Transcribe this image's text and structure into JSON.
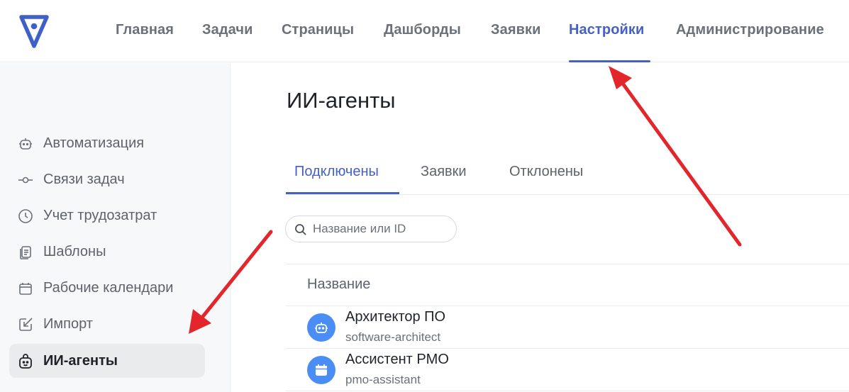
{
  "topnav": {
    "items": [
      {
        "label": "Главная"
      },
      {
        "label": "Задачи"
      },
      {
        "label": "Страницы"
      },
      {
        "label": "Дашборды"
      },
      {
        "label": "Заявки"
      },
      {
        "label": "Настройки",
        "active": true
      },
      {
        "label": "Администрирование"
      }
    ]
  },
  "sidebar": {
    "items": [
      {
        "label": "Автоматизация",
        "icon": "robot-icon"
      },
      {
        "label": "Связи задач",
        "icon": "link-node-icon"
      },
      {
        "label": "Учет трудозатрат",
        "icon": "clock-icon"
      },
      {
        "label": "Шаблоны",
        "icon": "template-icon"
      },
      {
        "label": "Рабочие календари",
        "icon": "calendar-icon"
      },
      {
        "label": "Импорт",
        "icon": "import-icon"
      },
      {
        "label": "ИИ-агенты",
        "icon": "ai-agent-icon",
        "active": true
      }
    ]
  },
  "main": {
    "title": "ИИ-агенты",
    "tabs": [
      {
        "label": "Подключены",
        "active": true
      },
      {
        "label": "Заявки"
      },
      {
        "label": "Отклонены"
      }
    ],
    "search": {
      "placeholder": "Название или ID",
      "value": ""
    },
    "table": {
      "header": "Название",
      "rows": [
        {
          "name": "Архитектор ПО",
          "id": "software-architect",
          "icon": "robot-icon"
        },
        {
          "name": "Ассистент PMO",
          "id": "pmo-assistant",
          "icon": "calendar-icon"
        }
      ]
    }
  },
  "colors": {
    "accent": "#4561c8",
    "avatar": "#4a8df4",
    "annotation": "#e3262b"
  }
}
